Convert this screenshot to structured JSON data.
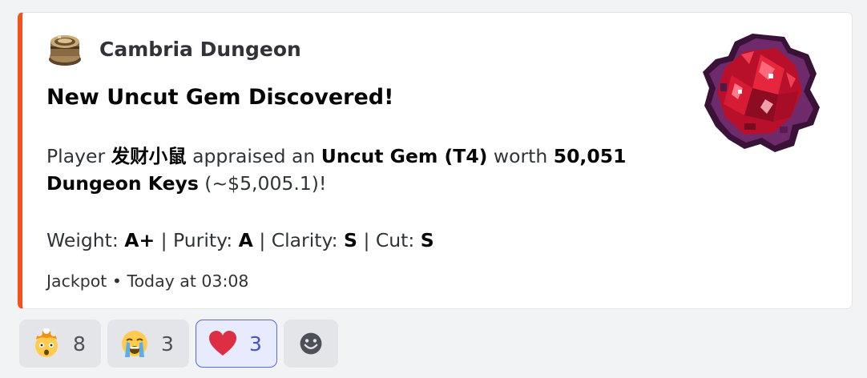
{
  "embed": {
    "accent_color": "#f2531d",
    "author": {
      "name": "Cambria Dungeon",
      "icon": "treasure-barrel-icon"
    },
    "title": "New Uncut Gem Discovered!",
    "description": {
      "prefix": "Player ",
      "player": "发财小鼠",
      "mid": " appraised an ",
      "item": "Uncut Gem (T4)",
      "worth": " worth ",
      "amount": "50,051 Dungeon Keys",
      "usd": " (~$5,005.1)!"
    },
    "stats": [
      {
        "label": "Weight: ",
        "value": "A+"
      },
      {
        "label": "Purity: ",
        "value": "A"
      },
      {
        "label": "Clarity: ",
        "value": "S"
      },
      {
        "label": "Cut: ",
        "value": "S"
      }
    ],
    "stat_separator": " | ",
    "footer": {
      "text": "Jackpot",
      "separator": " • ",
      "timestamp": "Today at 03:08"
    },
    "thumbnail": "red-uncut-gem-image"
  },
  "reactions": [
    {
      "emoji": "exploding-head-emoji",
      "count": "8",
      "active": false
    },
    {
      "emoji": "loudly-crying-face-emoji",
      "count": "3",
      "active": false
    },
    {
      "emoji": "red-heart-emoji",
      "count": "3",
      "active": true
    }
  ],
  "add_reaction": {
    "icon": "add-reaction-smiley-icon"
  }
}
